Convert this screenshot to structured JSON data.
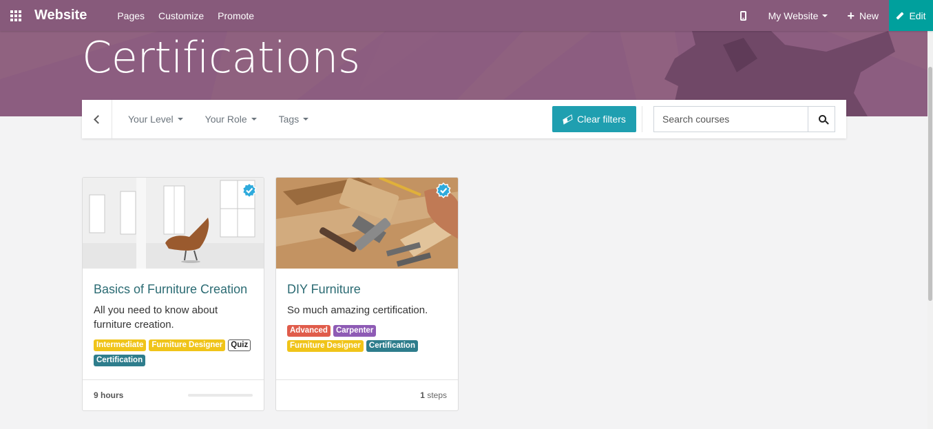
{
  "navbar": {
    "brand": "Website",
    "menu": [
      "Pages",
      "Customize",
      "Promote"
    ],
    "site_selector": "My Website",
    "new_label": "New",
    "edit_label": "Edit",
    "colors": {
      "bar": "#875a7b",
      "edit": "#00a09d"
    }
  },
  "banner": {
    "title": "Certifications"
  },
  "filters": {
    "level": "Your Level",
    "role": "Your Role",
    "tags": "Tags",
    "clear_label": "Clear filters",
    "search_placeholder": "Search courses"
  },
  "courses": [
    {
      "title": "Basics of Furniture Creation",
      "description": "All you need to know about furniture creation.",
      "tags": [
        "Intermediate",
        "Furniture Designer",
        "Quiz",
        "Certification"
      ],
      "duration": "9 hours",
      "progress": 0
    },
    {
      "title": "DIY Furniture",
      "description": "So much amazing certification.",
      "tags": [
        "Advanced",
        "Carpenter",
        "Furniture Designer",
        "Certification"
      ],
      "steps_count": "1",
      "steps_label": "steps"
    }
  ]
}
